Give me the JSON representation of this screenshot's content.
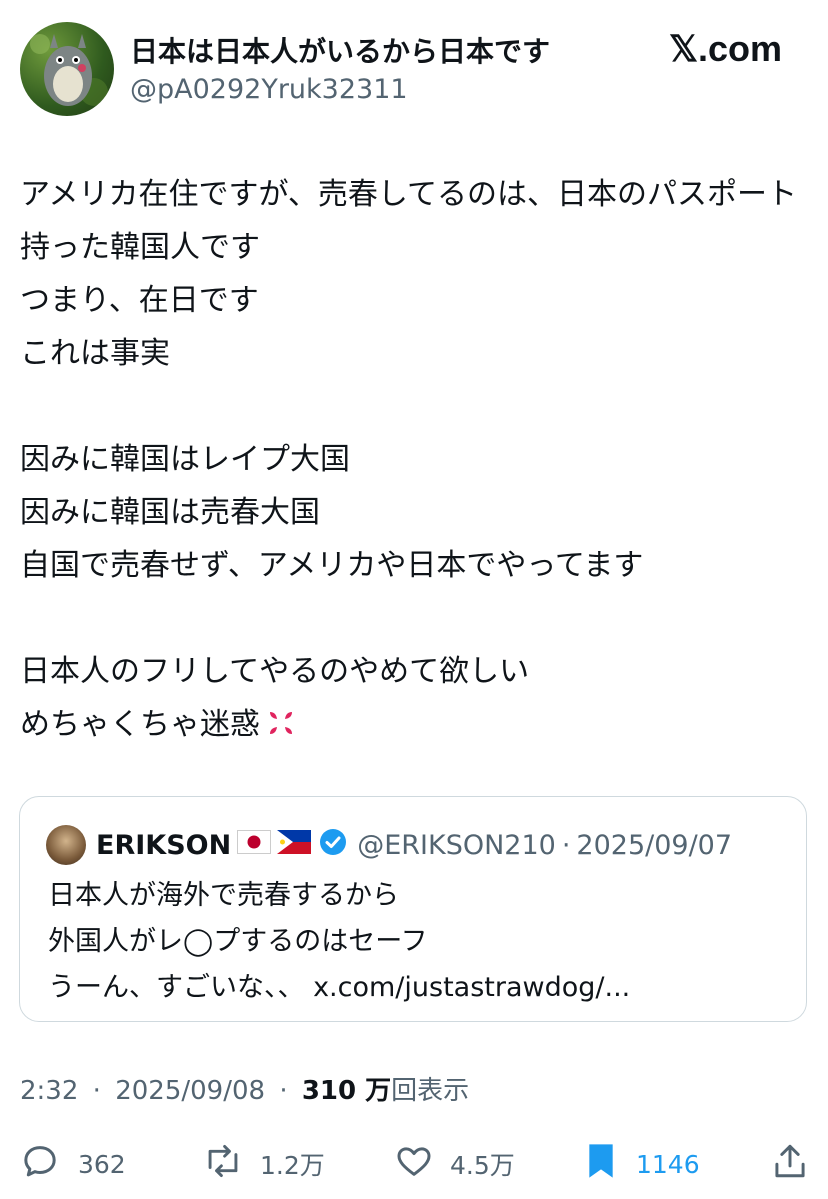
{
  "header": {
    "display_name": "日本は日本人がいるから日本です",
    "handle": "@pA0292Yruk32311",
    "site_label": "𝕏.com"
  },
  "tweet": {
    "lines": [
      "アメリカ在住ですが、売春してるのは、日本のパスポート持った韓国人です",
      "つまり、在日です",
      "これは事実",
      "因みに韓国はレイプ大国",
      "因みに韓国は売春大国",
      "自国で売春せず、アメリカや日本でやってます",
      "日本人のフリしてやるのやめて欲しい",
      "めちゃくちゃ迷惑"
    ]
  },
  "quote": {
    "name": "ERIKSON",
    "handle": "@ERIKSON210",
    "date": "2025/09/07",
    "separator": "·",
    "lines": [
      "日本人が海外で売春するから",
      "外国人がレ◯プするのはセーフ",
      "うーん、すごいな、、 x.com/justastrawdog/..."
    ]
  },
  "meta": {
    "time": "2:32",
    "date": "2025/09/08",
    "separator": "·",
    "views_count": "310 万",
    "views_label": "回表示"
  },
  "actions": {
    "replies": "362",
    "reposts": "1.2万",
    "likes": "4.5万",
    "bookmarks": "1146"
  },
  "colors": {
    "text": "#0f1419",
    "secondary": "#536471",
    "accent": "#1d9bf0",
    "border": "#cfd9de"
  },
  "icons": [
    "reply-icon",
    "repost-icon",
    "like-icon",
    "bookmark-icon",
    "share-icon",
    "verified-icon",
    "anger-icon"
  ]
}
